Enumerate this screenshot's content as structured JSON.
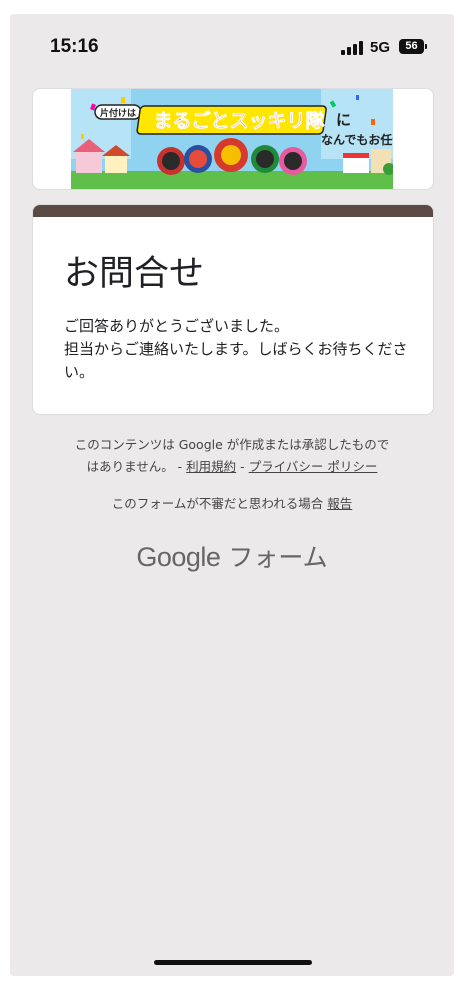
{
  "status_bar": {
    "time": "15:16",
    "network": "5G",
    "battery": "56"
  },
  "banner": {
    "tag_text": "片付けは",
    "headline": "まるごとスッキリ隊",
    "tagline_1": "に",
    "tagline_2": "なんでもお任せ!"
  },
  "form": {
    "title": "お問合せ",
    "message": "ご回答ありがとうございました。\n担当からご連絡いたします。しばらくお待ちください。",
    "accent_color": "#5b4a43"
  },
  "footer": {
    "disclaimer_line1": "このコンテンツは Google が作成または承認したもので",
    "disclaimer_line2_prefix": "はありません。 -",
    "terms_link": "利用規約",
    "separator": "-",
    "privacy_link": "プライバシー ポリシー",
    "report_prefix": "このフォームが不審だと思われる場合",
    "report_link": "報告",
    "logo_google": "Google",
    "logo_forms": "フォーム"
  }
}
